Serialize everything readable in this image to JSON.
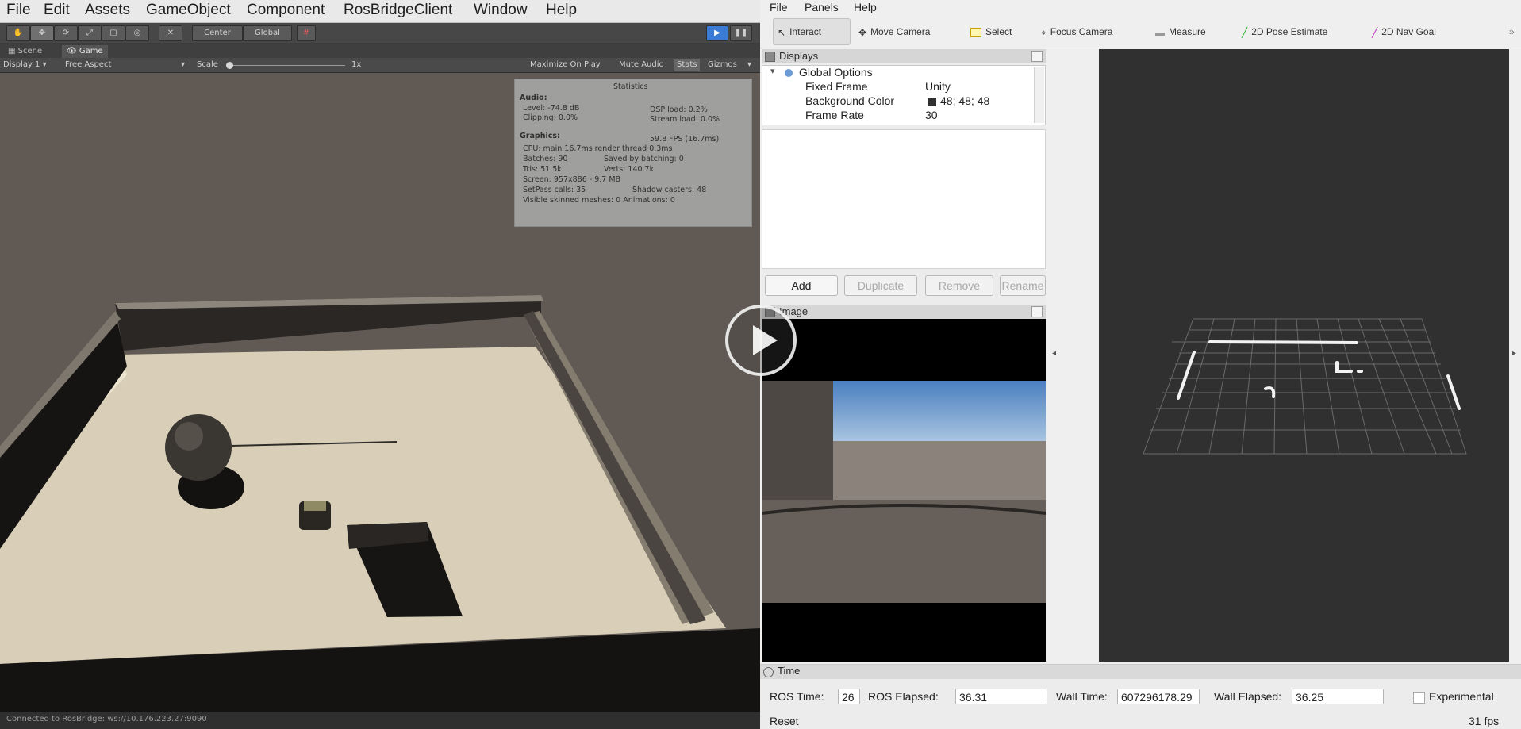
{
  "unity": {
    "menu": [
      "File",
      "Edit",
      "Assets",
      "GameObject",
      "Component",
      "RosBridgeClient",
      "Window",
      "Help"
    ],
    "toolbar": {
      "pivot_label": "Center",
      "space_label": "Global"
    },
    "tabs": {
      "scene": "Scene",
      "game": "Game"
    },
    "gamebar": {
      "display": "Display 1",
      "aspect": "Free Aspect",
      "scale_label": "Scale",
      "scale_value": "1x",
      "maximize": "Maximize On Play",
      "mute": "Mute Audio",
      "stats": "Stats",
      "gizmos": "Gizmos"
    },
    "stats": {
      "title": "Statistics",
      "audio_header": "Audio:",
      "level": "Level: -74.8 dB",
      "clipping": "Clipping: 0.0%",
      "dsp": "DSP load: 0.2%",
      "stream": "Stream load: 0.0%",
      "graphics_header": "Graphics:",
      "fps": "59.8 FPS (16.7ms)",
      "cpu": "CPU: main 16.7ms  render thread 0.3ms",
      "batches": "Batches: 90",
      "saved": "Saved by batching: 0",
      "tris": "Tris: 51.5k",
      "verts": "Verts: 140.7k",
      "screen": "Screen: 957x886 - 9.7 MB",
      "setpass": "SetPass calls: 35",
      "shadow": "Shadow casters: 48",
      "skinned": "Visible skinned meshes: 0  Animations: 0"
    },
    "status": "Connected to RosBridge: ws://10.176.223.27:9090"
  },
  "rviz": {
    "menu": [
      "File",
      "Panels",
      "Help"
    ],
    "tools": [
      "Interact",
      "Move Camera",
      "Select",
      "Focus Camera",
      "Measure",
      "2D Pose Estimate",
      "2D Nav Goal"
    ],
    "displays": {
      "title": "Displays",
      "global_options": "Global Options",
      "rows": [
        {
          "key": "Fixed Frame",
          "value": "Unity"
        },
        {
          "key": "Background Color",
          "value": "48; 48; 48"
        },
        {
          "key": "Frame Rate",
          "value": "30"
        }
      ],
      "buttons": [
        "Add",
        "Duplicate",
        "Remove",
        "Rename"
      ]
    },
    "image_panel_title": "Image",
    "time": {
      "title": "Time",
      "ros_time_label": "ROS Time:",
      "ros_time_value": "26",
      "ros_elapsed_label": "ROS Elapsed:",
      "ros_elapsed_value": "36.31",
      "wall_time_label": "Wall Time:",
      "wall_time_value": "607296178.29",
      "wall_elapsed_label": "Wall Elapsed:",
      "wall_elapsed_value": "36.25",
      "experimental_label": "Experimental",
      "reset_label": "Reset",
      "fps": "31 fps"
    }
  },
  "colors": {
    "unity_bg": "#3c3c3c",
    "rviz_bg": "#efefef",
    "viewport_bg": "#303030",
    "floor": "#d9cfb8",
    "background_color_swatch": "#303030"
  }
}
